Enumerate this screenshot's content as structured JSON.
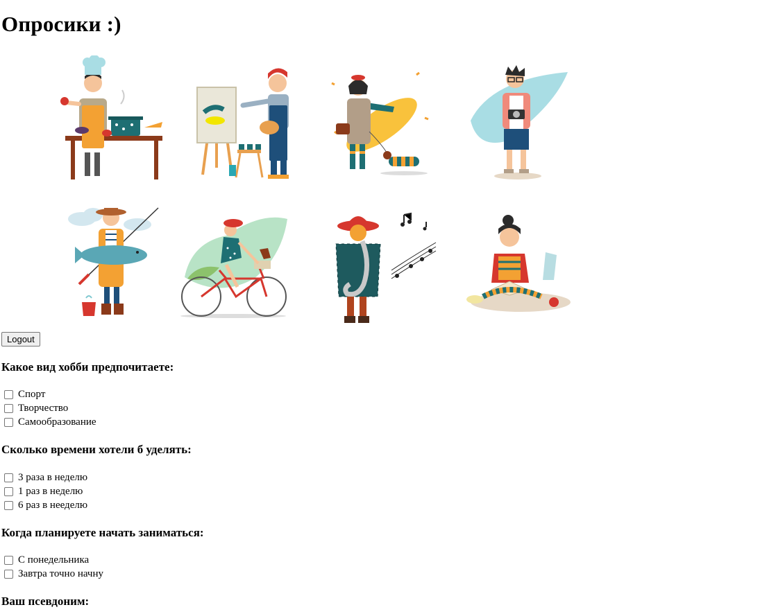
{
  "page": {
    "title": "Опросики :)"
  },
  "gallery": {
    "images": [
      {
        "name": "chef-cooking",
        "icon": "chef-illustration"
      },
      {
        "name": "painter-at-easel",
        "icon": "painter-illustration"
      },
      {
        "name": "woman-walking-dog",
        "icon": "walker-illustration"
      },
      {
        "name": "photographer",
        "icon": "photographer-illustration"
      },
      {
        "name": "fisherman-with-fish",
        "icon": "fisherman-illustration"
      },
      {
        "name": "woman-cycling",
        "icon": "cyclist-illustration"
      },
      {
        "name": "saxophone-player",
        "icon": "musician-illustration"
      },
      {
        "name": "girl-reading-book",
        "icon": "reader-illustration"
      }
    ]
  },
  "logout": {
    "label": "Logout"
  },
  "questions": [
    {
      "text": "Какое вид хобби предпочитаете:",
      "options": [
        "Спорт",
        "Творчество",
        "Самообразование"
      ]
    },
    {
      "text": "Сколько времени хотели б уделять:",
      "options": [
        "3 раза в неделю",
        "1 раз в неделю",
        "6 раз в нееделю"
      ]
    },
    {
      "text": "Когда планируете начать заниматься:",
      "options": [
        "С понедельника",
        "Завтра точно начну"
      ]
    },
    {
      "text": "Ваш псевдоним:",
      "options": []
    }
  ],
  "colors": {
    "orange": "#f3a133",
    "red": "#d6372e",
    "teal": "#1e6f73",
    "skyblue": "#a9dde4",
    "skin": "#f5c49b"
  }
}
